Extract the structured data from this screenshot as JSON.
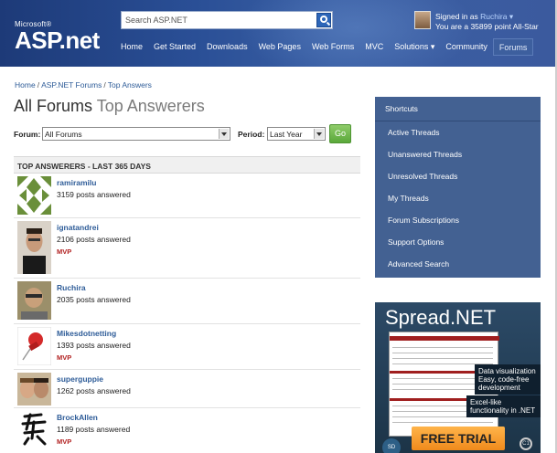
{
  "header": {
    "logo_small": "Microsoft®",
    "logo_main": "ASP.net",
    "search_placeholder": "Search ASP.NET",
    "signed_in_prefix": "Signed in as",
    "user_name": "Ruchira",
    "user_caret": "▾",
    "user_points": "You are a 35899 point All-Star",
    "nav": [
      "Home",
      "Get Started",
      "Downloads",
      "Web Pages",
      "Web Forms",
      "MVC",
      "Solutions ▾",
      "Community",
      "Forums"
    ],
    "active_nav": "Forums"
  },
  "breadcrumb": [
    "Home",
    "ASP.NET Forums",
    "Top Answers"
  ],
  "title": {
    "primary": "All Forums",
    "secondary": "Top Answerers"
  },
  "filters": {
    "forum_label": "Forum:",
    "forum_value": "All Forums",
    "period_label": "Period:",
    "period_value": "Last Year",
    "go_label": "Go"
  },
  "top_answerers": {
    "header": "TOP ANSWERERS - LAST 365 DAYS",
    "rows": [
      {
        "name": "ramiramilu",
        "posts": "3159 posts answered",
        "badge": ""
      },
      {
        "name": "ignatandrei",
        "posts": "2106 posts answered",
        "badge": "MVP"
      },
      {
        "name": "Ruchira",
        "posts": "2035 posts answered",
        "badge": ""
      },
      {
        "name": "Mikesdotnetting",
        "posts": "1393 posts answered",
        "badge": "MVP"
      },
      {
        "name": "superguppie",
        "posts": "1262 posts answered",
        "badge": ""
      },
      {
        "name": "BrockAllen",
        "posts": "1189 posts answered",
        "badge": "MVP"
      }
    ]
  },
  "sidebar": {
    "header": "Shortcuts",
    "links": [
      "Active Threads",
      "Unanswered Threads",
      "Unresolved Threads",
      "My Threads",
      "Forum Subscriptions",
      "Support Options",
      "Advanced Search"
    ]
  },
  "ad": {
    "title": "Spread.NET",
    "tip1": "Data visualization Easy, code-free development",
    "tip2": "Excel-like functionality in .NET",
    "cta": "FREE TRIAL",
    "badge_left": "SD",
    "badge_right": "C1"
  },
  "colors": {
    "header_blue": "#2a4f96",
    "link_blue": "#2e5c98",
    "sidebar_bg": "#436192",
    "mvp_red": "#b22222",
    "go_green": "#5aa83a",
    "cta_orange": "#f08a1c"
  }
}
